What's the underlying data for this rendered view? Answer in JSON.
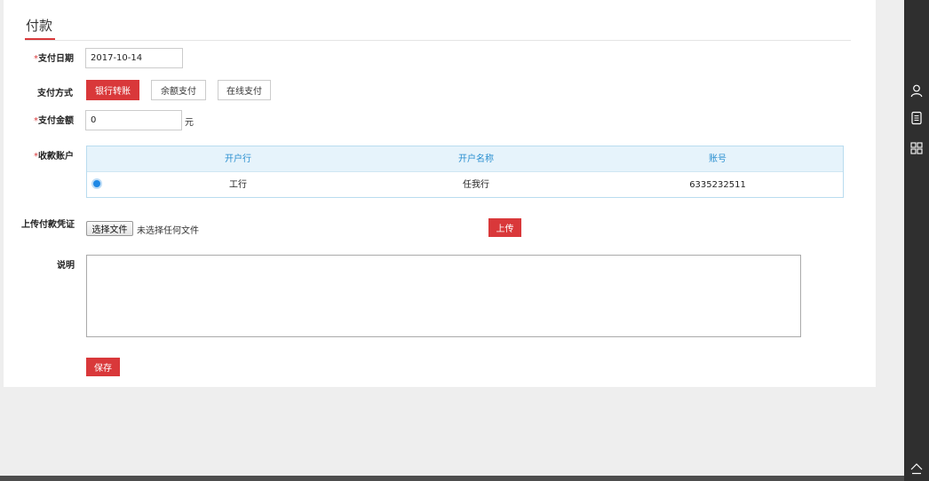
{
  "page": {
    "title": "付款"
  },
  "form": {
    "date": {
      "label": "支付日期",
      "value": "2017-10-14"
    },
    "method": {
      "label": "支付方式",
      "options": [
        "银行转账",
        "余额支付",
        "在线支付"
      ],
      "selected": "银行转账"
    },
    "amount": {
      "label": "支付金额",
      "value": "0",
      "unit": "元"
    },
    "account": {
      "label": "收款账户",
      "columns": [
        "开户行",
        "开户名称",
        "账号"
      ],
      "rows": [
        {
          "bank": "工行",
          "name": "任我行",
          "number": "6335232511",
          "selected": true
        }
      ]
    },
    "upload": {
      "label": "上传付款凭证",
      "choose_label": "选择文件",
      "no_file_text": "未选择任何文件",
      "upload_label": "上传"
    },
    "note": {
      "label": "说明",
      "value": ""
    },
    "save_label": "保存"
  },
  "required_mark": "*",
  "colors": {
    "accent": "#d9383a",
    "table_header_bg": "#e6f3fb",
    "table_header_text": "#2a8fd0",
    "sidebar": "#2f2f2f"
  },
  "sidebar": {
    "icons": [
      "user-icon",
      "document-icon",
      "apps-icon",
      "scroll-top-icon"
    ]
  }
}
